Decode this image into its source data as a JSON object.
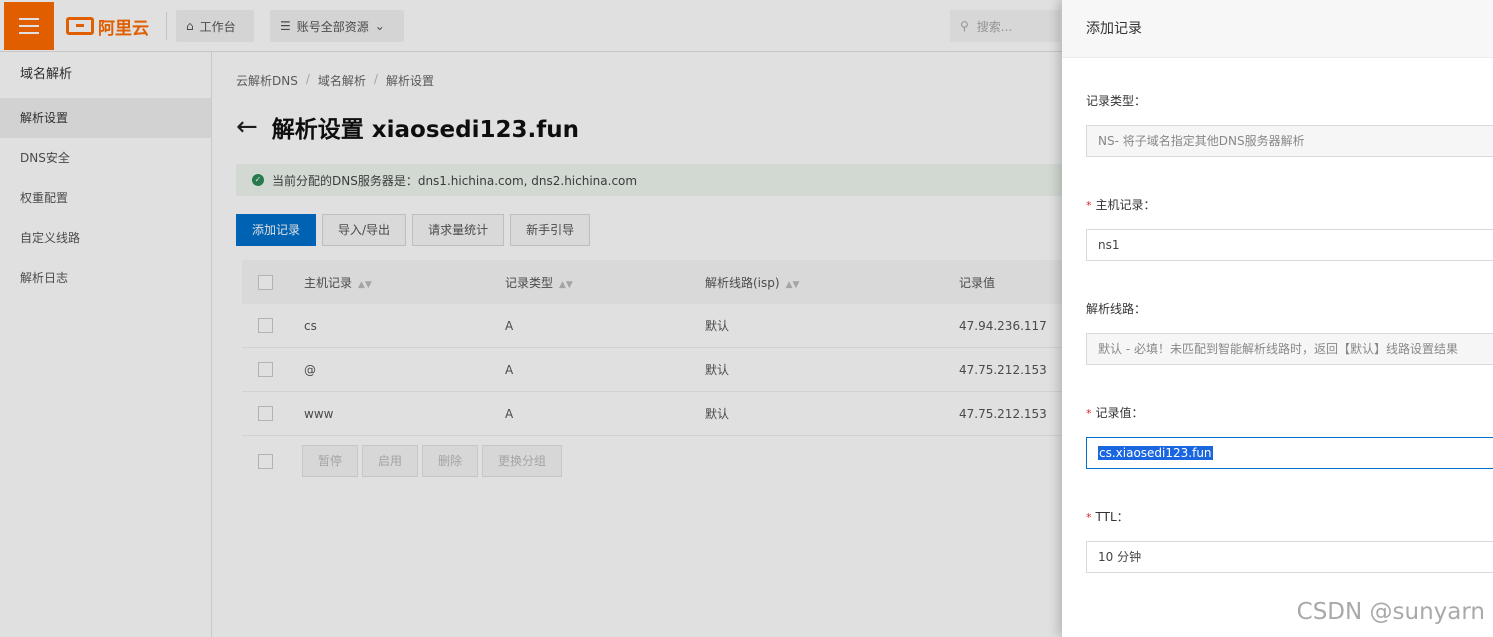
{
  "topbar": {
    "logo_text": "阿里云",
    "workbench_label": "工作台",
    "resources_label": "账号全部资源",
    "search_placeholder": "搜索..."
  },
  "sidebar": {
    "title": "域名解析",
    "items": [
      {
        "label": "解析设置",
        "active": true
      },
      {
        "label": "DNS安全",
        "active": false
      },
      {
        "label": "权重配置",
        "active": false
      },
      {
        "label": "自定义线路",
        "active": false
      },
      {
        "label": "解析日志",
        "active": false
      }
    ]
  },
  "main": {
    "breadcrumb": [
      "云解析DNS",
      "域名解析",
      "解析设置"
    ],
    "title": "解析设置 xiaosedi123.fun",
    "notice": "当前分配的DNS服务器是：dns1.hichina.com, dns2.hichina.com",
    "toolbar": {
      "add": "添加记录",
      "import_export": "导入/导出",
      "stats": "请求量统计",
      "guide": "新手引导"
    },
    "table": {
      "headers": {
        "host": "主机记录",
        "type": "记录类型",
        "line": "解析线路(isp)",
        "value": "记录值"
      },
      "rows": [
        {
          "host": "cs",
          "type": "A",
          "line": "默认",
          "value": "47.94.236.117"
        },
        {
          "host": "@",
          "type": "A",
          "line": "默认",
          "value": "47.75.212.153"
        },
        {
          "host": "www",
          "type": "A",
          "line": "默认",
          "value": "47.75.212.153"
        }
      ]
    },
    "batch": {
      "pause": "暂停",
      "enable": "启用",
      "delete": "删除",
      "change_group": "更换分组"
    }
  },
  "drawer": {
    "title": "添加记录",
    "record_type": {
      "label": "记录类型：",
      "value": "NS- 将子域名指定其他DNS服务器解析"
    },
    "host": {
      "label": "主机记录：",
      "value": "ns1"
    },
    "line": {
      "label": "解析线路：",
      "value": "默认 - 必填！未匹配到智能解析线路时，返回【默认】线路设置结果"
    },
    "record_value": {
      "label": "记录值：",
      "value": "cs.xiaosedi123.fun"
    },
    "ttl": {
      "label": "TTL：",
      "value": "10 分钟"
    },
    "required_mark": "*"
  },
  "watermark": "CSDN @sunyarn",
  "colors": {
    "brand": "#ff6a00",
    "primary": "#0070cc"
  }
}
